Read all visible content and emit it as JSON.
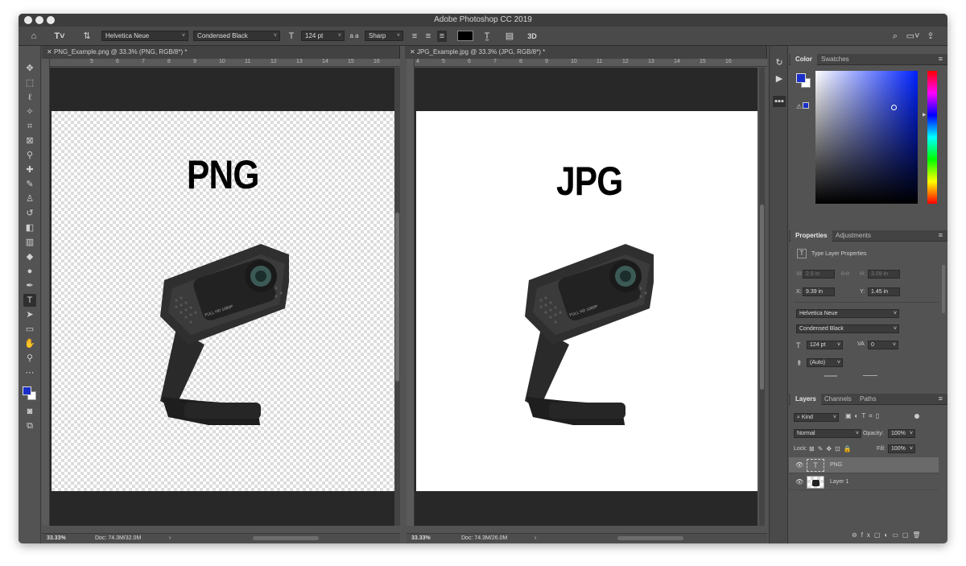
{
  "app": {
    "title": "Adobe Photoshop CC 2019"
  },
  "options": {
    "font_family": "Helvetica Neue",
    "font_style": "Condensed Black",
    "font_size": "124 pt",
    "antialias_label": "a a",
    "antialias": "Sharp",
    "mode_3d": "3D"
  },
  "docs": [
    {
      "tab": "PNG_Example.png @ 33.3% (PNG, RGB/8*) *",
      "text": "PNG",
      "zoom": "33.33%",
      "doc": "Doc: 74.3M/32.0M",
      "ruler": [
        "5",
        "6",
        "7",
        "8",
        "9",
        "10",
        "11",
        "12",
        "13",
        "14",
        "15",
        "16"
      ]
    },
    {
      "tab": "JPG_Example.jpg @ 33.3% (JPG, RGB/8*) *",
      "text": "JPG",
      "zoom": "33.33%",
      "doc": "Doc: 74.3M/26.0M",
      "ruler": [
        "4",
        "5",
        "6",
        "7",
        "8",
        "9",
        "10",
        "11",
        "12",
        "13",
        "14",
        "15",
        "16"
      ]
    }
  ],
  "status_arrow": "›",
  "webcam_label": "FULL HD 1080P",
  "color_panel": {
    "tabs": [
      "Color",
      "Swatches"
    ],
    "foreground": "#1a2fc8",
    "gradient_hue": "#0022ff"
  },
  "properties": {
    "tabs": [
      "Properties",
      "Adjustments"
    ],
    "header": "Type Layer Properties",
    "w_label": "W:",
    "w": "2.8 in",
    "h_label": "H:",
    "h": "3.09 in",
    "x_label": "X:",
    "x": "9.39 in",
    "y_label": "Y:",
    "y": "1.45 in",
    "font_family": "Helvetica Neue",
    "font_style": "Condensed Black",
    "font_size": "124 pt",
    "tracking": "0",
    "leading": "(Auto)"
  },
  "layers": {
    "tabs": [
      "Layers",
      "Channels",
      "Paths"
    ],
    "kind": "Kind",
    "blend": "Normal",
    "opacity_label": "Opacity:",
    "opacity": "100%",
    "lock_label": "Lock:",
    "fill_label": "Fill:",
    "fill": "100%",
    "items": [
      {
        "name": "PNG",
        "type": "T"
      },
      {
        "name": "Layer 1",
        "type": "img"
      }
    ]
  }
}
